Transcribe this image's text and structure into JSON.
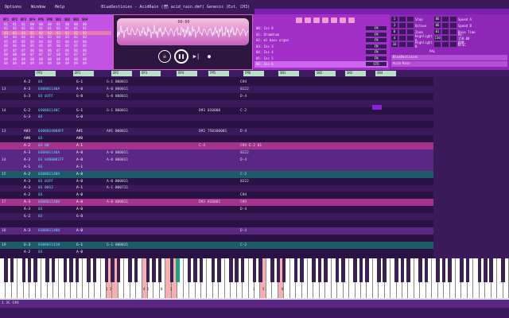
{
  "window": {
    "menus": [
      "Options",
      "Window",
      "Help"
    ],
    "title": "BlueDestinies - AcidRain (🗃 acid_rain.dmf) Genesis (Ext. CH3)"
  },
  "pattern_matrix": {
    "headers": [
      "OP1",
      "OP2",
      "OP3",
      "OP4",
      "FM5",
      "FM6",
      "SN1",
      "SN2",
      "SN3",
      "SN4"
    ],
    "rows": [
      [
        "01",
        "01",
        "01",
        "00",
        "00",
        "00",
        "01",
        "00",
        "00",
        "00"
      ],
      [
        "02",
        "02",
        "02",
        "01",
        "01",
        "01",
        "02",
        "01",
        "01",
        "01"
      ],
      [
        "03",
        "03",
        "03",
        "02",
        "02",
        "02",
        "03",
        "02",
        "02",
        "02"
      ],
      [
        "04",
        "04",
        "04",
        "03",
        "03",
        "03",
        "04",
        "03",
        "03",
        "03"
      ],
      [
        "05",
        "05",
        "05",
        "04",
        "04",
        "04",
        "05",
        "04",
        "04",
        "04"
      ],
      [
        "06",
        "06",
        "06",
        "05",
        "05",
        "05",
        "06",
        "05",
        "05",
        "05"
      ],
      [
        "07",
        "07",
        "07",
        "06",
        "06",
        "06",
        "07",
        "06",
        "06",
        "06"
      ],
      [
        "08",
        "08",
        "08",
        "07",
        "07",
        "07",
        "08",
        "07",
        "07",
        "07"
      ],
      [
        "09",
        "09",
        "09",
        "08",
        "08",
        "08",
        "09",
        "08",
        "08",
        "08"
      ],
      [
        "0A",
        "0A",
        "0A",
        "09",
        "09",
        "09",
        "0A",
        "09",
        "09",
        "09"
      ]
    ]
  },
  "scope": {
    "time": "00:00"
  },
  "instruments": {
    "items": [
      {
        "label": "00: Ins 0",
        "tag": "FM"
      },
      {
        "label": "01: Drumdrum",
        "tag": "FM"
      },
      {
        "label": "02: ml bass organ",
        "tag": "FM"
      },
      {
        "label": "03: Ins 3",
        "tag": "FM"
      },
      {
        "label": "04: Ins 4",
        "tag": "FM"
      },
      {
        "label": "05: Ins 5",
        "tag": "FM"
      },
      {
        "label": "06: Ins 6",
        "tag": "STD"
      }
    ]
  },
  "settings": {
    "rows": [
      {
        "a": "1",
        "la": "Step",
        "b": "06",
        "lb": "Speed A"
      },
      {
        "a": "3",
        "la": "Octave",
        "b": "06",
        "lb": "Speed B"
      },
      {
        "a": "0",
        "la": "Zoom",
        "b": "01",
        "lb": "Base Time"
      },
      {
        "a": "4",
        "la": "Highlight A",
        "b": "150",
        "lb": "Hz: 150.00 BPM"
      },
      {
        "a": "16",
        "la": "Highlight B",
        "b": "",
        "lb": "NTSC"
      }
    ],
    "pal": "PAL",
    "song_name": "BlueDestinies",
    "author": "Acid Rain"
  },
  "tracks": [
    "FM1",
    "OP1",
    "OP2",
    "OP3",
    "OP4",
    "FM5",
    "FM6",
    "SN1",
    "SN2",
    "SN3",
    "SN4"
  ],
  "grid": {
    "rows": [
      {
        "n": "",
        "a": "A-2",
        "b": "03",
        "c": "G-1",
        "d": "G-1 000011",
        "e": "",
        "f": "C#4"
      },
      {
        "n": "13",
        "a": "A-3",
        "b": "030801140A",
        "c": "A-0",
        "d": "A-0 000011",
        "e": "",
        "f": "0222"
      },
      {
        "n": "",
        "a": "G-3",
        "b": "03 03FF",
        "c": "G-0",
        "d": "G-0 000011",
        "e": "",
        "f": "D-4"
      },
      {
        "n": "",
        "a": "",
        "b": "",
        "c": "",
        "d": "",
        "e": "",
        "f": ""
      },
      {
        "n": "14",
        "a": "G-2",
        "b": "030801140C",
        "c": "G-1",
        "d": "G-1 000011",
        "e": "D#3 010000",
        "f": "C-2"
      },
      {
        "n": "",
        "a": "G-3",
        "b": "03",
        "c": "G-0",
        "d": "",
        "e": "",
        "f": ""
      },
      {
        "n": "",
        "a": "",
        "b": "",
        "c": "",
        "d": "",
        "e": "",
        "f": ""
      },
      {
        "n": "13",
        "a": "A#3",
        "b": "0308014008FF",
        "c": "A#1",
        "d": "A#1 000011",
        "e": "D#2 750100001",
        "f": "D-4"
      },
      {
        "n": "",
        "a": "A#0",
        "b": "03",
        "c": "A#0",
        "d": "",
        "e": "",
        "f": ""
      },
      {
        "n": "",
        "a": "A-2",
        "b": "03 00",
        "c": "A-1",
        "d": "",
        "e": "C-4",
        "f": "C#4 E-2 01"
      },
      {
        "n": "",
        "a": "A-3",
        "b": "030801140A",
        "c": "A-0",
        "d": "A-0 000011",
        "e": "",
        "f": "0222"
      },
      {
        "n": "14",
        "a": "A-3",
        "b": "03 0400001FF",
        "c": "A-0",
        "d": "A-0 000011",
        "e": "",
        "f": "D-4"
      },
      {
        "n": "",
        "a": "A-1",
        "b": "03",
        "c": "A-1",
        "d": "",
        "e": "",
        "f": ""
      },
      {
        "n": "15",
        "a": "A-2",
        "b": "030801140A",
        "c": "A-0",
        "d": "",
        "e": "",
        "f": "C-2"
      },
      {
        "n": "",
        "a": "A-3",
        "b": "03 03FF",
        "c": "A-0",
        "d": "A-0 000011",
        "e": "",
        "f": "0222"
      },
      {
        "n": "",
        "a": "A-3",
        "b": "03 0012",
        "c": "A-1",
        "d": "A-1 000711",
        "e": "",
        "f": ""
      },
      {
        "n": "",
        "a": "A-2",
        "b": "03",
        "c": "A-0",
        "d": "",
        "e": "",
        "f": "C#4"
      },
      {
        "n": "17",
        "a": "A-3",
        "b": "0308011400",
        "c": "A-0",
        "d": "A-0 000011",
        "e": "D#3 010001",
        "f": "C#4"
      },
      {
        "n": "",
        "a": "A-3",
        "b": "03",
        "c": "A-0",
        "d": "",
        "e": "",
        "f": "D-4"
      },
      {
        "n": "",
        "a": "G-2",
        "b": "03",
        "c": "G-0",
        "d": "",
        "e": "",
        "f": ""
      },
      {
        "n": "",
        "a": "",
        "b": "",
        "c": "",
        "d": "",
        "e": "",
        "f": ""
      },
      {
        "n": "18",
        "a": "A-3",
        "b": "0308011400",
        "c": "A-0",
        "d": "",
        "e": "",
        "f": "D-4"
      },
      {
        "n": "",
        "a": "",
        "b": "",
        "c": "",
        "d": "",
        "e": "",
        "f": ""
      },
      {
        "n": "19",
        "a": "G-3",
        "b": "0308011410",
        "c": "G-1",
        "d": "G-1 000011",
        "e": "",
        "f": "C-2"
      },
      {
        "n": "",
        "a": "A-2",
        "b": "03",
        "c": "A-0",
        "d": "",
        "e": "",
        "f": ""
      }
    ]
  },
  "piano_labels": [
    "1 2",
    "4 5",
    "8",
    "2",
    "3",
    "5",
    "8"
  ],
  "footer": {
    "status": "1 3C  C#4"
  }
}
